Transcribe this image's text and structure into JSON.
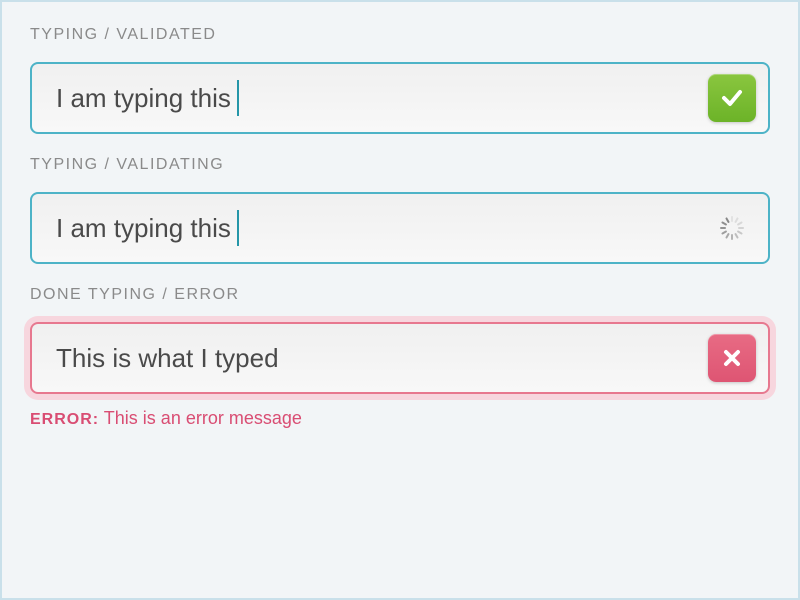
{
  "fields": {
    "validated": {
      "label": "TYPING / VALIDATED",
      "value": "I am typing this"
    },
    "validating": {
      "label": "TYPING / VALIDATING",
      "value": "I am typing this"
    },
    "error": {
      "label": "DONE TYPING / ERROR",
      "value": "This is what I typed",
      "error_prefix": "ERROR:",
      "error_message": "This is an error message"
    }
  }
}
